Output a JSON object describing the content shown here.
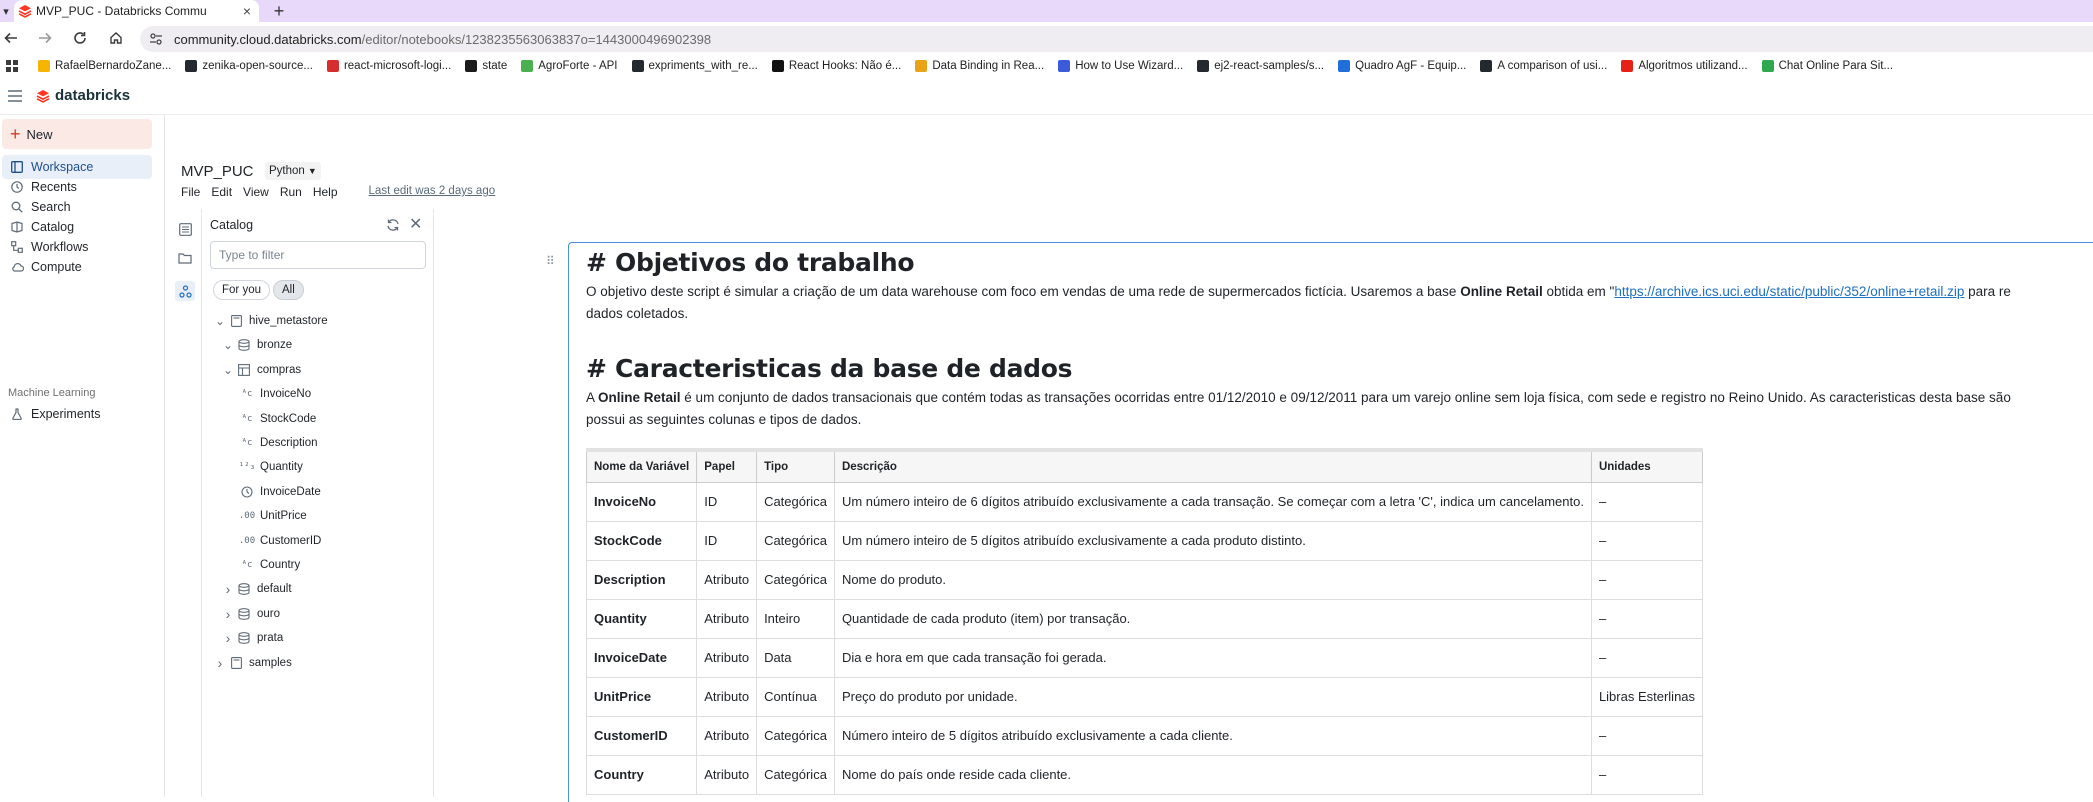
{
  "browser": {
    "tab_title": "MVP_PUC - Databricks Commu",
    "url_host": "community.cloud.databricks.com",
    "url_path": "/editor/notebooks/1238235563063837o=1443000496902398",
    "bookmarks": [
      {
        "label": "RafaelBernardoZane...",
        "color": "#f4b400"
      },
      {
        "label": "zenika-open-source...",
        "color": "#24292f"
      },
      {
        "label": "react-microsoft-logi...",
        "color": "#d62e2e"
      },
      {
        "label": "state",
        "color": "#1b1b1b"
      },
      {
        "label": "AgroForte - API",
        "color": "#4caf50"
      },
      {
        "label": "expriments_with_re...",
        "color": "#24292f"
      },
      {
        "label": "React Hooks: Não é...",
        "color": "#111111"
      },
      {
        "label": "Data Binding in Rea...",
        "color": "#e8a317"
      },
      {
        "label": "How to Use Wizard...",
        "color": "#3b5bdb"
      },
      {
        "label": "ej2-react-samples/s...",
        "color": "#24292f"
      },
      {
        "label": "Quadro AgF - Equip...",
        "color": "#1e6fd9"
      },
      {
        "label": "A comparison of usi...",
        "color": "#24292f"
      },
      {
        "label": "Algoritmos utilizand...",
        "color": "#e62117"
      },
      {
        "label": "Chat Online Para Sit...",
        "color": "#2fa84f"
      }
    ]
  },
  "app": {
    "brand": "databricks",
    "accent": "#ff3621"
  },
  "leftnav": {
    "new_label": "New",
    "items": [
      {
        "label": "Workspace",
        "icon": "workspace-icon"
      },
      {
        "label": "Recents",
        "icon": "clock-icon"
      },
      {
        "label": "Search",
        "icon": "search-icon"
      },
      {
        "label": "Catalog",
        "icon": "catalog-icon"
      },
      {
        "label": "Workflows",
        "icon": "workflows-icon"
      },
      {
        "label": "Compute",
        "icon": "cloud-icon"
      }
    ],
    "ml_header": "Machine Learning",
    "ml_items": [
      {
        "label": "Experiments",
        "icon": "flask-icon"
      }
    ]
  },
  "notebook": {
    "title": "MVP_PUC",
    "language": "Python",
    "menu": [
      "File",
      "Edit",
      "View",
      "Run",
      "Help"
    ],
    "last_edit": "Last edit was 2 days ago"
  },
  "catalog": {
    "title": "Catalog",
    "filter_placeholder": "Type to filter",
    "pills": [
      "For you",
      "All"
    ],
    "tree": [
      {
        "label": "hive_metastore",
        "chev": "v",
        "icon": "database-icon"
      },
      {
        "label": "bronze",
        "chev": "v",
        "icon": "schema-icon"
      },
      {
        "label": "compras",
        "chev": "v",
        "icon": "table-icon"
      },
      {
        "label": "InvoiceNo",
        "chev": "",
        "icon": "string-type-icon"
      },
      {
        "label": "StockCode",
        "chev": "",
        "icon": "string-type-icon"
      },
      {
        "label": "Description",
        "chev": "",
        "icon": "string-type-icon"
      },
      {
        "label": "Quantity",
        "chev": "",
        "icon": "integer-type-icon"
      },
      {
        "label": "InvoiceDate",
        "chev": "",
        "icon": "timestamp-type-icon"
      },
      {
        "label": "UnitPrice",
        "chev": "",
        "icon": "decimal-type-icon"
      },
      {
        "label": "CustomerID",
        "chev": "",
        "icon": "decimal-type-icon"
      },
      {
        "label": "Country",
        "chev": "",
        "icon": "string-type-icon"
      },
      {
        "label": "default",
        "chev": ">",
        "icon": "schema-icon"
      },
      {
        "label": "ouro",
        "chev": ">",
        "icon": "schema-icon"
      },
      {
        "label": "prata",
        "chev": ">",
        "icon": "schema-icon"
      },
      {
        "label": "samples",
        "chev": ">",
        "icon": "database-icon"
      }
    ]
  },
  "cell": {
    "heading1": "# Objetivos do trabalho",
    "p1_pre": "O objetivo deste script é simular a criação de um data warehouse com foco em vendas de uma rede de supermercados fictícia. Usaremos a base ",
    "p1_bold": "Online Retail",
    "p1_mid": " obtida em \"",
    "p1_link": "https://archive.ics.uci.edu/static/public/352/online+retail.zip",
    "p1_post": " para re",
    "p1_line2": "dados coletados.",
    "heading2": "# Caracteristicas da base de dados",
    "p2_pre": "A ",
    "p2_bold": "Online Retail",
    "p2_post": " é um conjunto de dados transacionais que contém todas as transações ocorridas entre 01/12/2010 e 09/12/2011 para um varejo online sem loja física, com sede e registro no Reino Unido. As caracteristicas desta base são ",
    "p2_line2": "possui as seguintes colunas e tipos de dados.",
    "table": {
      "headers": [
        "Nome da Variável",
        "Papel",
        "Tipo",
        "Descrição",
        "Unidades"
      ],
      "rows": [
        [
          "InvoiceNo",
          "ID",
          "Categórica",
          "Um número inteiro de 6 dígitos atribuído exclusivamente a cada transação. Se começar com a letra 'C', indica um cancelamento.",
          "–"
        ],
        [
          "StockCode",
          "ID",
          "Categórica",
          "Um número inteiro de 5 dígitos atribuído exclusivamente a cada produto distinto.",
          "–"
        ],
        [
          "Description",
          "Atributo",
          "Categórica",
          "Nome do produto.",
          "–"
        ],
        [
          "Quantity",
          "Atributo",
          "Inteiro",
          "Quantidade de cada produto (item) por transação.",
          "–"
        ],
        [
          "InvoiceDate",
          "Atributo",
          "Data",
          "Dia e hora em que cada transação foi gerada.",
          "–"
        ],
        [
          "UnitPrice",
          "Atributo",
          "Contínua",
          "Preço do produto por unidade.",
          "Libras Esterlinas"
        ],
        [
          "CustomerID",
          "Atributo",
          "Categórica",
          "Número inteiro de 5 dígitos atribuído exclusivamente a cada cliente.",
          "–"
        ],
        [
          "Country",
          "Atributo",
          "Categórica",
          "Nome do país onde reside cada cliente.",
          "–"
        ]
      ]
    }
  }
}
